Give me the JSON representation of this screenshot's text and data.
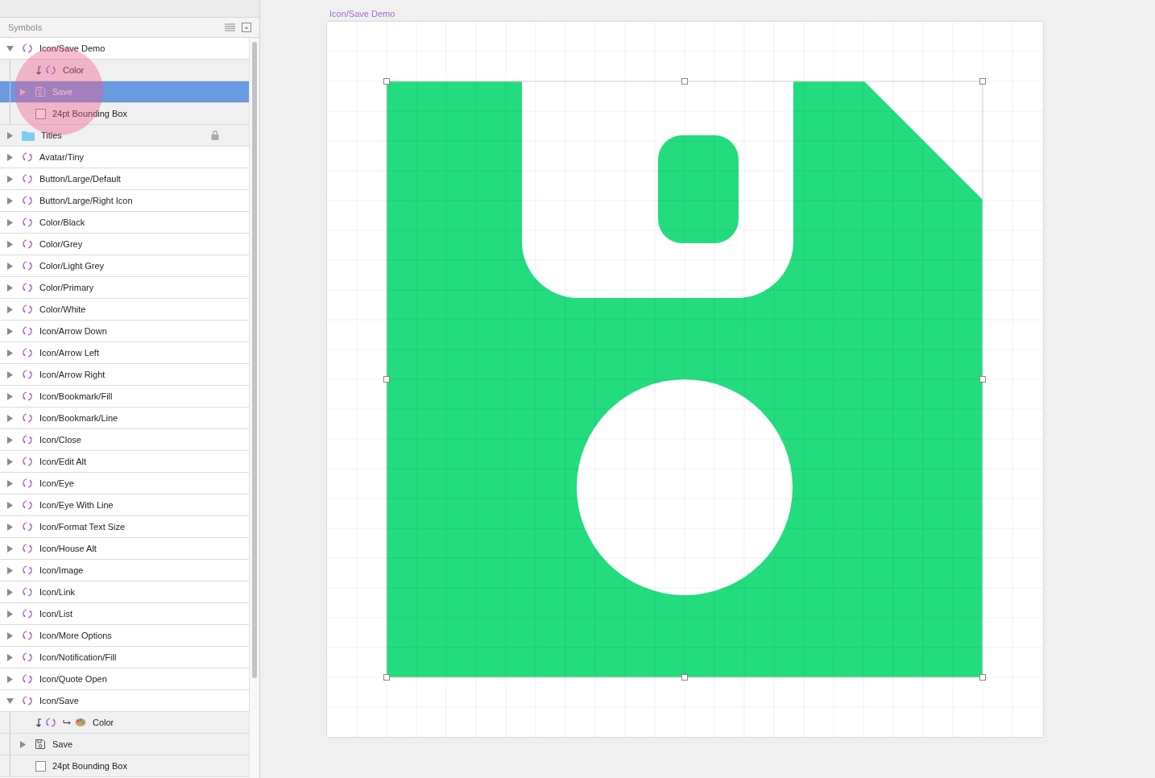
{
  "panel": {
    "title": "Symbols"
  },
  "layers": [
    {
      "kind": "symbol",
      "name": "Icon/Save Demo",
      "expanded": true,
      "selected": false,
      "locked": false,
      "children": [
        {
          "kind": "override",
          "name": "Color",
          "selected": false,
          "locked": false
        },
        {
          "kind": "group",
          "name": "Save",
          "expanded": false,
          "selected": true,
          "locked": false
        },
        {
          "kind": "rect",
          "name": "24pt Bounding Box",
          "selected": false,
          "locked": false
        }
      ]
    },
    {
      "kind": "folder",
      "name": "Titles",
      "expanded": false,
      "selected": false,
      "locked": true
    },
    {
      "kind": "symbol",
      "name": "Avatar/Tiny",
      "expanded": false,
      "selected": false,
      "locked": false
    },
    {
      "kind": "symbol",
      "name": "Button/Large/Default",
      "expanded": false,
      "selected": false,
      "locked": false
    },
    {
      "kind": "symbol",
      "name": "Button/Large/Right Icon",
      "expanded": false,
      "selected": false,
      "locked": false
    },
    {
      "kind": "symbol",
      "name": "Color/Black",
      "expanded": false,
      "selected": false,
      "locked": false
    },
    {
      "kind": "symbol",
      "name": "Color/Grey",
      "expanded": false,
      "selected": false,
      "locked": false
    },
    {
      "kind": "symbol",
      "name": "Color/Light Grey",
      "expanded": false,
      "selected": false,
      "locked": false
    },
    {
      "kind": "symbol",
      "name": "Color/Primary",
      "expanded": false,
      "selected": false,
      "locked": false
    },
    {
      "kind": "symbol",
      "name": "Color/White",
      "expanded": false,
      "selected": false,
      "locked": false
    },
    {
      "kind": "symbol",
      "name": "Icon/Arrow Down",
      "expanded": false,
      "selected": false,
      "locked": false
    },
    {
      "kind": "symbol",
      "name": "Icon/Arrow Left",
      "expanded": false,
      "selected": false,
      "locked": false
    },
    {
      "kind": "symbol",
      "name": "Icon/Arrow Right",
      "expanded": false,
      "selected": false,
      "locked": false
    },
    {
      "kind": "symbol",
      "name": "Icon/Bookmark/Fill",
      "expanded": false,
      "selected": false,
      "locked": false
    },
    {
      "kind": "symbol",
      "name": "Icon/Bookmark/Line",
      "expanded": false,
      "selected": false,
      "locked": false
    },
    {
      "kind": "symbol",
      "name": "Icon/Close",
      "expanded": false,
      "selected": false,
      "locked": false
    },
    {
      "kind": "symbol",
      "name": "Icon/Edit Alt",
      "expanded": false,
      "selected": false,
      "locked": false
    },
    {
      "kind": "symbol",
      "name": "Icon/Eye",
      "expanded": false,
      "selected": false,
      "locked": false
    },
    {
      "kind": "symbol",
      "name": "Icon/Eye With Line",
      "expanded": false,
      "selected": false,
      "locked": false
    },
    {
      "kind": "symbol",
      "name": "Icon/Format Text Size",
      "expanded": false,
      "selected": false,
      "locked": false
    },
    {
      "kind": "symbol",
      "name": "Icon/House Alt",
      "expanded": false,
      "selected": false,
      "locked": false
    },
    {
      "kind": "symbol",
      "name": "Icon/Image",
      "expanded": false,
      "selected": false,
      "locked": false
    },
    {
      "kind": "symbol",
      "name": "Icon/Link",
      "expanded": false,
      "selected": false,
      "locked": false
    },
    {
      "kind": "symbol",
      "name": "Icon/List",
      "expanded": false,
      "selected": false,
      "locked": false
    },
    {
      "kind": "symbol",
      "name": "Icon/More Options",
      "expanded": false,
      "selected": false,
      "locked": false
    },
    {
      "kind": "symbol",
      "name": "Icon/Notification/Fill",
      "expanded": false,
      "selected": false,
      "locked": false
    },
    {
      "kind": "symbol",
      "name": "Icon/Quote Open",
      "expanded": false,
      "selected": false,
      "locked": false
    },
    {
      "kind": "symbol",
      "name": "Icon/Save",
      "expanded": true,
      "selected": false,
      "locked": false,
      "children": [
        {
          "kind": "style_override",
          "name": "Color",
          "selected": false,
          "locked": false
        },
        {
          "kind": "group",
          "name": "Save",
          "expanded": false,
          "selected": false,
          "locked": false
        },
        {
          "kind": "rect",
          "name": "24pt Bounding Box",
          "selected": false,
          "locked": false
        }
      ]
    }
  ],
  "artboard": {
    "title": "Icon/Save Demo"
  }
}
